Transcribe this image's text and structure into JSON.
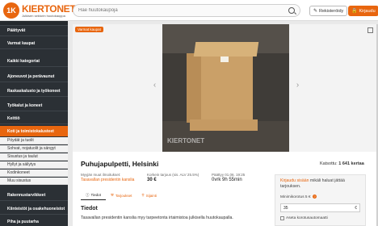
{
  "header": {
    "logo_badge": "1K",
    "logo_name": "KIERTONET",
    "logo_tagline": "Julkisen sektorin huutokauppa",
    "search_placeholder": "Hae huutokaupoja",
    "register_label": "Rekisteröidy",
    "login_label": "Kirjaudu"
  },
  "sidebar": {
    "items": [
      {
        "label": "Päättyvät",
        "type": "main"
      },
      {
        "label": "Varmat kaupat",
        "type": "main"
      },
      {
        "label": "Kaikki kategoriat",
        "type": "main"
      },
      {
        "label": "Ajoneuvot ja perävaunut",
        "type": "main"
      },
      {
        "label": "Raskaskalusto ja työkoneet",
        "type": "main"
      },
      {
        "label": "Työkalut ja koneet",
        "type": "main"
      },
      {
        "label": "Keittiö",
        "type": "main"
      },
      {
        "label": "Koti ja toimistokalusteet",
        "type": "active"
      },
      {
        "label": "Pöydät ja tuolit",
        "type": "sub"
      },
      {
        "label": "Sohvat, nojatuolit ja sängyt",
        "type": "sub"
      },
      {
        "label": "Sisustus ja taulut",
        "type": "sub"
      },
      {
        "label": "Hyllyt ja säilytys",
        "type": "sub"
      },
      {
        "label": "Kodinkoneet",
        "type": "sub"
      },
      {
        "label": "Muu sisustus",
        "type": "sub"
      },
      {
        "label": "Rakennustarvikkeet",
        "type": "main"
      },
      {
        "label": "Kiinteistöt ja osakehuoneistot",
        "type": "main"
      },
      {
        "label": "Piha ja puutarha",
        "type": "main"
      }
    ]
  },
  "listing": {
    "badge": "Varmat kaupat",
    "watermark": "KIERTONET",
    "title": "Puhujapulpetti, Helsinki",
    "views_label": "Katsottu:",
    "views_count": "1 641 kertaa",
    "seller_label": "Myyjän muut ilmoitukset:",
    "seller_name": "Tasavallan presidentin kanslia",
    "price_label": "Korkein tarjous (sis. ALV 25.5%)",
    "price_value": "30 €",
    "end_label": "Päättyy 01.06. 19:25",
    "end_value": "0vrk 9h 55min"
  },
  "tabs": [
    {
      "label": "Tiedot",
      "icon": "info-icon",
      "active": true
    },
    {
      "label": "Tarjoukset",
      "icon": "gavel-icon",
      "active": false
    },
    {
      "label": "Sijainti",
      "icon": "pin-icon",
      "active": false
    }
  ],
  "details": {
    "heading": "Tiedot",
    "description": "Tasavallan presidentin kanslia myy tarpeetonta irtaimistoa julkisella huutokaupalla."
  },
  "bid": {
    "login_link": "Kirjaudu sisään",
    "login_rest": " mikäli haluat jättää tarjouksen.",
    "min_raise_label": "Minimikorotus 5 €",
    "input_value": "35",
    "unit": "€",
    "auto_bid_label": "Aseta korotusautomaatti"
  },
  "colors": {
    "accent": "#e8660f",
    "sidebar": "#2b3035"
  }
}
